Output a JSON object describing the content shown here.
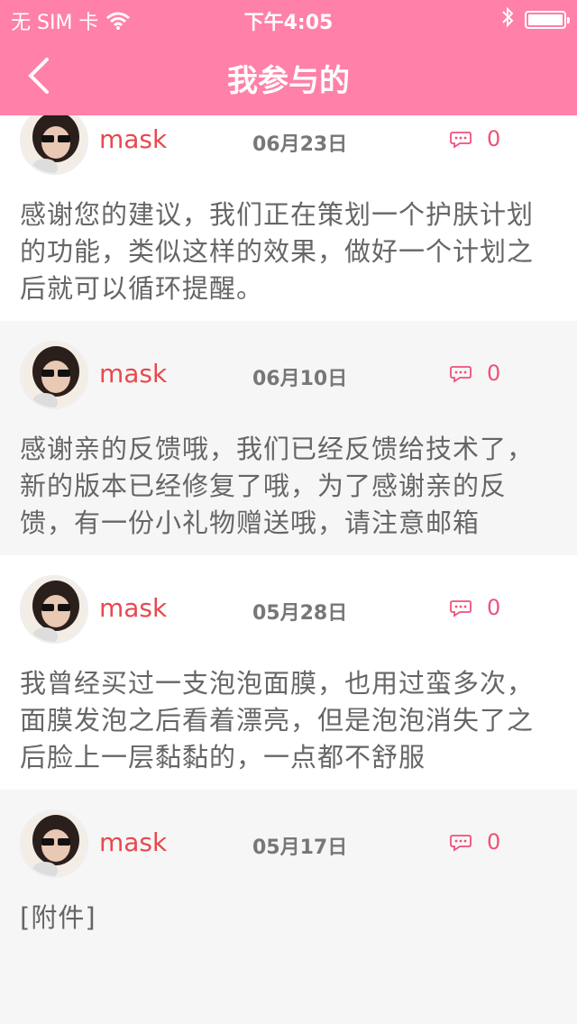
{
  "status_bar": {
    "carrier": "无 SIM 卡",
    "time": "下午4:05"
  },
  "nav": {
    "title": "我参与的"
  },
  "posts": [
    {
      "username": "mask",
      "date": "06月23日",
      "comments": "0",
      "content": "感谢您的建议，我们正在策划一个护肤计划的功能，类似这样的效果，做好一个计划之后就可以循环提醒。"
    },
    {
      "username": "mask",
      "date": "06月10日",
      "comments": "0",
      "content": "感谢亲的反馈哦，我们已经反馈给技术了，新的版本已经修复了哦，为了感谢亲的反馈，有一份小礼物赠送哦，请注意邮箱"
    },
    {
      "username": "mask",
      "date": "05月28日",
      "comments": "0",
      "content": "我曾经买过一支泡泡面膜，也用过蛮多次，面膜发泡之后看着漂亮，但是泡泡消失了之后脸上一层黏黏的，一点都不舒服"
    },
    {
      "username": "mask",
      "date": "05月17日",
      "comments": "0",
      "content": "[附件]"
    }
  ],
  "colors": {
    "header": "#ff80a8",
    "username": "#e8484e",
    "comment": "#f0507a"
  }
}
